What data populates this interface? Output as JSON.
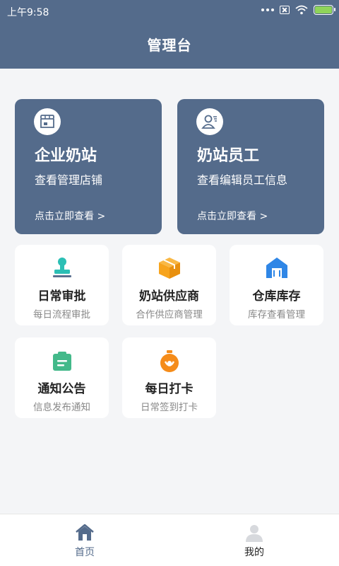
{
  "status_bar": {
    "time": "上午9:58"
  },
  "header": {
    "title": "管理台"
  },
  "big_cards": [
    {
      "title": "企业奶站",
      "subtitle": "查看管理店铺",
      "link": "点击立即查看 >"
    },
    {
      "title": "奶站员工",
      "subtitle": "查看编辑员工信息",
      "link": "点击立即查看 >"
    }
  ],
  "tiles": [
    {
      "title": "日常审批",
      "subtitle": "每日流程审批",
      "icon": "stamp-icon",
      "color": "#2bbfb5"
    },
    {
      "title": "奶站供应商",
      "subtitle": "合作供应商管理",
      "icon": "box-icon",
      "color": "#f7a41d"
    },
    {
      "title": "仓库库存",
      "subtitle": "库存查看管理",
      "icon": "warehouse-icon",
      "color": "#2f86e6"
    },
    {
      "title": "通知公告",
      "subtitle": "信息发布通知",
      "icon": "notice-icon",
      "color": "#43b98a"
    },
    {
      "title": "每日打卡",
      "subtitle": "日常签到打卡",
      "icon": "clock-in-icon",
      "color": "#f58c1a"
    }
  ],
  "tabbar": {
    "items": [
      {
        "label": "首页",
        "icon": "home-icon",
        "active": true
      },
      {
        "label": "我的",
        "icon": "user-icon",
        "active": false
      }
    ],
    "active_color": "#546b8b",
    "inactive_color": "#222222"
  }
}
